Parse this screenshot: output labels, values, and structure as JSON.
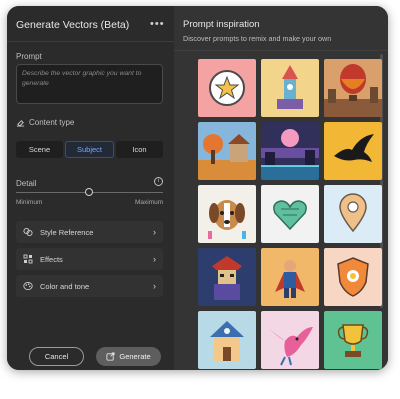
{
  "panel": {
    "title": "Generate Vectors (Beta)",
    "menu_glyph": "•••",
    "prompt_label": "Prompt",
    "prompt_placeholder": "Describe the vector graphic you want to generate",
    "content_type_label": "Content type",
    "content_types": [
      "Scene",
      "Subject",
      "Icon"
    ],
    "selected_content_type": "Subject",
    "detail_label": "Detail",
    "detail_info_glyph": "i",
    "detail_min": "Minimum",
    "detail_max": "Maximum",
    "detail_level": 0.5,
    "accordions": [
      {
        "label": "Style Reference",
        "icon": "style-reference-icon"
      },
      {
        "label": "Effects",
        "icon": "effects-icon"
      },
      {
        "label": "Color and tone",
        "icon": "color-tone-icon"
      }
    ],
    "chevron_glyph": "›",
    "cancel_label": "Cancel",
    "generate_label": "Generate"
  },
  "inspiration": {
    "title": "Prompt inspiration",
    "subtitle": "Discover prompts to remix and make your own",
    "tiles": [
      {
        "name": "star-badge",
        "bg": "#f4a2a2"
      },
      {
        "name": "castle-tower",
        "bg": "#f2d58a"
      },
      {
        "name": "hot-air-balloon",
        "bg": "#d9a06b"
      },
      {
        "name": "autumn-landscape",
        "bg": "#87b6dc"
      },
      {
        "name": "neon-city",
        "bg": "#30305a"
      },
      {
        "name": "black-bird",
        "bg": "#f2b835"
      },
      {
        "name": "puppy-dog",
        "bg": "#f3f0ea"
      },
      {
        "name": "heart-leaves",
        "bg": "#f2f2f2"
      },
      {
        "name": "location-pin",
        "bg": "#dcecf7"
      },
      {
        "name": "samurai-warrior",
        "bg": "#2d3d6d"
      },
      {
        "name": "hero-figure",
        "bg": "#f2b86a"
      },
      {
        "name": "flower-shield",
        "bg": "#f7d7c4"
      },
      {
        "name": "fantasy-house",
        "bg": "#b8d9e6"
      },
      {
        "name": "pink-bird",
        "bg": "#f4d7e4"
      },
      {
        "name": "trophy",
        "bg": "#5fc293"
      }
    ]
  },
  "colors": {
    "accent": "#73a9ff",
    "panel_bg": "#2b2b2b",
    "right_bg": "#343434"
  }
}
